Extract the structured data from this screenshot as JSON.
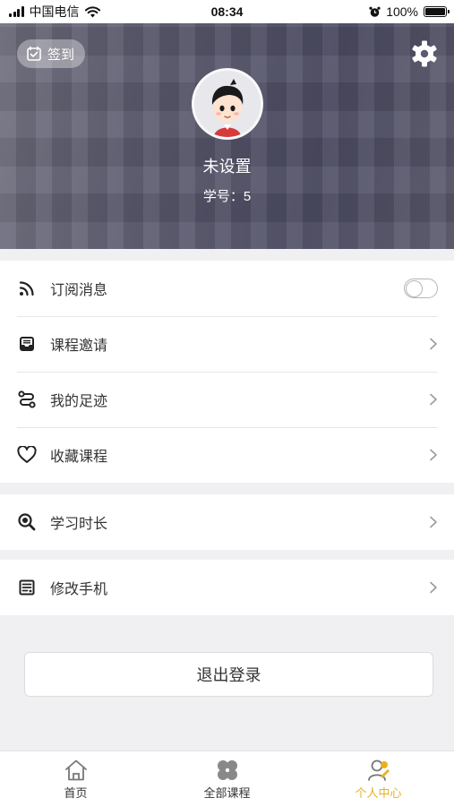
{
  "status_bar": {
    "carrier": "中国电信",
    "time": "08:34",
    "battery": "100%"
  },
  "header": {
    "checkin_label": "签到",
    "nickname": "未设置",
    "student_id": "学号：5"
  },
  "menu_group_1": [
    {
      "label": "订阅消息",
      "icon": "rss-icon",
      "control": "toggle",
      "toggle_on": false
    },
    {
      "label": "课程邀请",
      "icon": "inbox-icon",
      "control": "chevron"
    },
    {
      "label": "我的足迹",
      "icon": "route-icon",
      "control": "chevron"
    },
    {
      "label": "收藏课程",
      "icon": "heart-icon",
      "control": "chevron"
    }
  ],
  "menu_group_2": [
    {
      "label": "学习时长",
      "icon": "magnifier-icon",
      "control": "chevron"
    }
  ],
  "menu_group_3": [
    {
      "label": "修改手机",
      "icon": "form-icon",
      "control": "chevron"
    }
  ],
  "logout_label": "退出登录",
  "tabs": [
    {
      "label": "首页",
      "icon": "home-icon",
      "active": false
    },
    {
      "label": "全部课程",
      "icon": "clover-icon",
      "active": false
    },
    {
      "label": "个人中心",
      "icon": "person-icon",
      "active": true
    }
  ],
  "colors": {
    "accent": "#e7b21d",
    "page_bg": "#f0f0f3"
  }
}
